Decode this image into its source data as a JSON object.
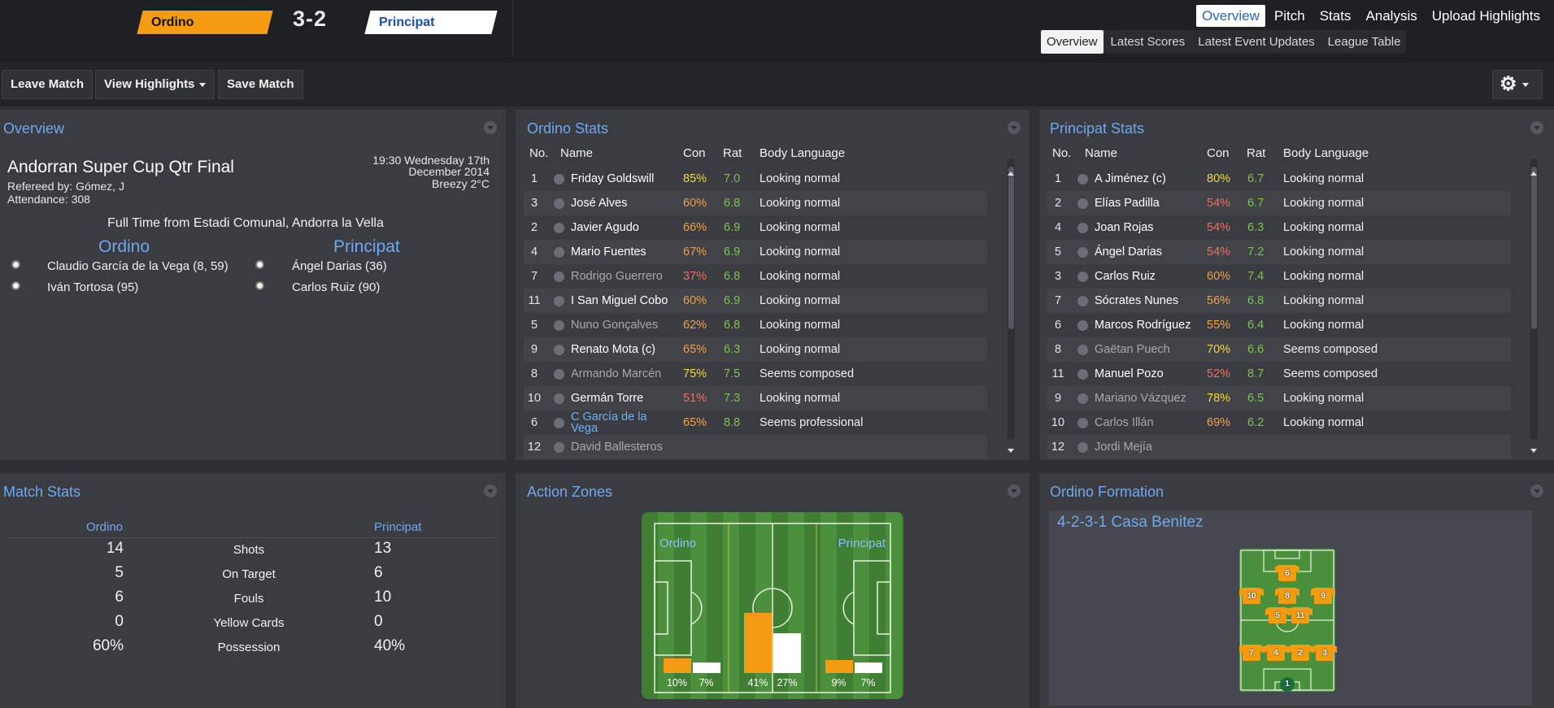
{
  "header": {
    "home_team": "Ordino",
    "away_team": "Principat",
    "score": "3-2",
    "main_nav": [
      "Overview",
      "Pitch",
      "Stats",
      "Analysis",
      "Upload Highlights"
    ],
    "sub_nav": [
      "Overview",
      "Latest Scores",
      "Latest Event Updates",
      "League Table"
    ]
  },
  "toolbar": {
    "leave_label": "Leave Match",
    "highlights_label": "View Highlights",
    "save_label": "Save Match"
  },
  "overview": {
    "title": "Overview",
    "competition": "Andorran Super Cup Qtr Final",
    "referee": "Refereed by: Gómez, J",
    "attendance": "Attendance: 308",
    "time_line1": "19:30 Wednesday 17th",
    "time_line2": "December 2014",
    "weather": "Breezy 2°C",
    "full_time": "Full Time from Estadi Comunal, Andorra la Vella",
    "home_team": "Ordino",
    "away_team": "Principat",
    "home_goals": [
      "Claudio García de la Vega (8, 59)",
      "Iván Tortosa (95)"
    ],
    "away_goals": [
      "Ángel Darias (36)",
      "Carlos Ruiz (90)"
    ]
  },
  "columns": {
    "no": "No.",
    "name": "Name",
    "con": "Con",
    "rat": "Rat",
    "body": "Body Language"
  },
  "home_stats": {
    "title": "Ordino Stats",
    "players": [
      {
        "no": "1",
        "name": "Friday Goldswill",
        "con": "85%",
        "rat": "7.0",
        "body": "Looking normal",
        "style": "bright"
      },
      {
        "no": "3",
        "name": "José Alves",
        "con": "60%",
        "rat": "6.8",
        "body": "Looking normal",
        "style": "bright"
      },
      {
        "no": "2",
        "name": "Javier Agudo",
        "con": "66%",
        "rat": "6.9",
        "body": "Looking normal",
        "style": "bright"
      },
      {
        "no": "4",
        "name": "Mario Fuentes",
        "con": "67%",
        "rat": "6.9",
        "body": "Looking normal",
        "style": "bright"
      },
      {
        "no": "7",
        "name": "Rodrigo Guerrero",
        "con": "37%",
        "rat": "6.8",
        "body": "Looking normal",
        "style": "dim"
      },
      {
        "no": "11",
        "name": "I San Miguel Cobo",
        "con": "60%",
        "rat": "6.9",
        "body": "Looking normal",
        "style": "bright"
      },
      {
        "no": "5",
        "name": "Nuno Gonçalves",
        "con": "62%",
        "rat": "6.8",
        "body": "Looking normal",
        "style": "dim"
      },
      {
        "no": "9",
        "name": "Renato Mota (c)",
        "con": "65%",
        "rat": "6.3",
        "body": "Looking normal",
        "style": "bright"
      },
      {
        "no": "8",
        "name": "Armando Marcén",
        "con": "75%",
        "rat": "7.5",
        "body": "Seems composed",
        "style": "dim"
      },
      {
        "no": "10",
        "name": "Germán Torre",
        "con": "51%",
        "rat": "7.3",
        "body": "Looking normal",
        "style": "bright"
      },
      {
        "no": "6",
        "name": "C García de la Vega",
        "con": "65%",
        "rat": "8.8",
        "body": "Seems professional",
        "style": "link"
      },
      {
        "no": "12",
        "name": "David Ballesteros",
        "con": "",
        "rat": "",
        "body": "",
        "style": "dim"
      }
    ]
  },
  "away_stats": {
    "title": "Principat Stats",
    "players": [
      {
        "no": "1",
        "name": "A Jiménez (c)",
        "con": "80%",
        "rat": "6.7",
        "body": "Looking normal",
        "style": "bright"
      },
      {
        "no": "2",
        "name": "Elías Padilla",
        "con": "54%",
        "rat": "6.7",
        "body": "Looking normal",
        "style": "bright"
      },
      {
        "no": "4",
        "name": "Joan Rojas",
        "con": "54%",
        "rat": "6.3",
        "body": "Looking normal",
        "style": "bright"
      },
      {
        "no": "5",
        "name": "Ángel Darias",
        "con": "54%",
        "rat": "7.2",
        "body": "Looking normal",
        "style": "bright"
      },
      {
        "no": "3",
        "name": "Carlos Ruiz",
        "con": "60%",
        "rat": "7.4",
        "body": "Looking normal",
        "style": "bright"
      },
      {
        "no": "7",
        "name": "Sócrates Nunes",
        "con": "56%",
        "rat": "6.8",
        "body": "Looking normal",
        "style": "bright"
      },
      {
        "no": "6",
        "name": "Marcos Rodríguez",
        "con": "55%",
        "rat": "6.4",
        "body": "Looking normal",
        "style": "bright"
      },
      {
        "no": "8",
        "name": "Gaëtan Puech",
        "con": "70%",
        "rat": "6.6",
        "body": "Seems composed",
        "style": "dim"
      },
      {
        "no": "11",
        "name": "Manuel Pozo",
        "con": "52%",
        "rat": "8.7",
        "body": "Seems composed",
        "style": "bright"
      },
      {
        "no": "9",
        "name": "Mariano Vázquez",
        "con": "78%",
        "rat": "6.5",
        "body": "Looking normal",
        "style": "dim"
      },
      {
        "no": "10",
        "name": "Carlos Illán",
        "con": "69%",
        "rat": "6.2",
        "body": "Looking normal",
        "style": "dim"
      },
      {
        "no": "12",
        "name": "Jordi Mejía",
        "con": "",
        "rat": "",
        "body": "",
        "style": "dim"
      }
    ]
  },
  "match_stats": {
    "title": "Match Stats",
    "home": "Ordino",
    "away": "Principat",
    "rows": [
      {
        "home": "14",
        "label": "Shots",
        "away": "13"
      },
      {
        "home": "5",
        "label": "On Target",
        "away": "6"
      },
      {
        "home": "6",
        "label": "Fouls",
        "away": "10"
      },
      {
        "home": "0",
        "label": "Yellow Cards",
        "away": "0"
      },
      {
        "home": "60%",
        "label": "Possession",
        "away": "40%"
      }
    ]
  },
  "action_zones": {
    "title": "Action Zones",
    "home": "Ordino",
    "away": "Principat",
    "zones": [
      {
        "home": 10,
        "away": 7,
        "home_label": "10%",
        "away_label": "7%"
      },
      {
        "home": 41,
        "away": 27,
        "home_label": "41%",
        "away_label": "27%"
      },
      {
        "home": 9,
        "away": 7,
        "home_label": "9%",
        "away_label": "7%"
      }
    ]
  },
  "formation": {
    "title": "Ordino Formation",
    "name": "4-2-3-1 Casa Benitez",
    "players": [
      "6",
      "10",
      "8",
      "9",
      "5",
      "11",
      "7",
      "4",
      "2",
      "3",
      "1"
    ]
  },
  "colors": {
    "accent": "#6fa8ee",
    "home": "#f39c12",
    "away": "#ffffff",
    "con_high": "#f5d742",
    "con_mid": "#f0a14a",
    "con_low": "#ef6e5f",
    "rating": "#7cc44d"
  }
}
